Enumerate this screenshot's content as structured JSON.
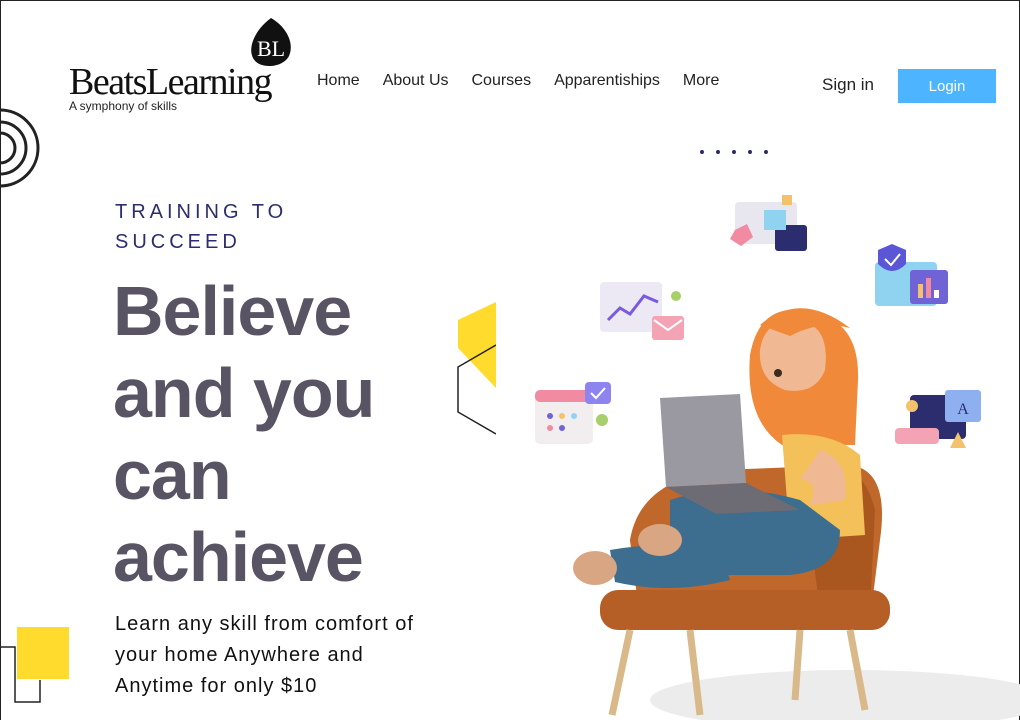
{
  "brand": {
    "badge_letters": "BL",
    "name": "BeatsLearning",
    "tagline": "A symphony of skills"
  },
  "nav": {
    "items": [
      {
        "label": "Home"
      },
      {
        "label": "About Us"
      },
      {
        "label": "Courses"
      },
      {
        "label": "Apparentiships"
      },
      {
        "label": "More"
      }
    ],
    "signin_label": "Sign in",
    "login_label": "Login"
  },
  "hero": {
    "eyebrow": "TRAINING TO SUCCEED",
    "headline": "Believe and you can achieve",
    "subtext": "Learn any skill from comfort of your home Anywhere and Anytime for only $10"
  },
  "colors": {
    "accent": "#4db4ff",
    "headline": "#585464",
    "eyebrow": "#2b2d6e",
    "yellow": "#ffdb2e"
  },
  "icons": {
    "badge": "bl-logo-badge-icon",
    "illustration": "girl-with-laptop-illustration"
  }
}
